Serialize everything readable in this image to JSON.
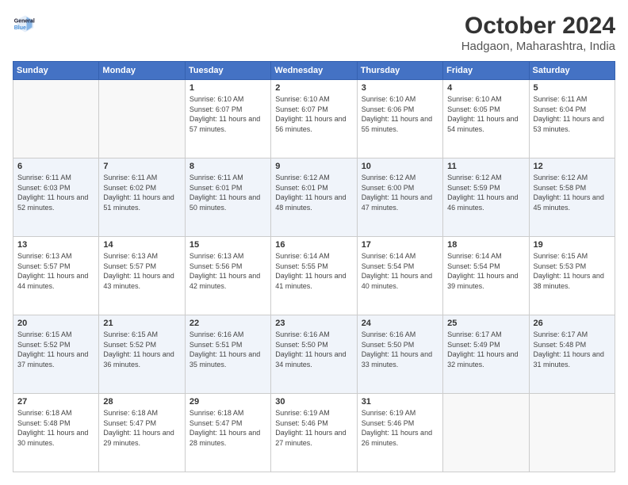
{
  "header": {
    "logo_line1": "General",
    "logo_line2": "Blue",
    "title": "October 2024",
    "subtitle": "Hadgaon, Maharashtra, India"
  },
  "days_of_week": [
    "Sunday",
    "Monday",
    "Tuesday",
    "Wednesday",
    "Thursday",
    "Friday",
    "Saturday"
  ],
  "weeks": [
    [
      {
        "day": "",
        "info": ""
      },
      {
        "day": "",
        "info": ""
      },
      {
        "day": "1",
        "info": "Sunrise: 6:10 AM\nSunset: 6:07 PM\nDaylight: 11 hours and 57 minutes."
      },
      {
        "day": "2",
        "info": "Sunrise: 6:10 AM\nSunset: 6:07 PM\nDaylight: 11 hours and 56 minutes."
      },
      {
        "day": "3",
        "info": "Sunrise: 6:10 AM\nSunset: 6:06 PM\nDaylight: 11 hours and 55 minutes."
      },
      {
        "day": "4",
        "info": "Sunrise: 6:10 AM\nSunset: 6:05 PM\nDaylight: 11 hours and 54 minutes."
      },
      {
        "day": "5",
        "info": "Sunrise: 6:11 AM\nSunset: 6:04 PM\nDaylight: 11 hours and 53 minutes."
      }
    ],
    [
      {
        "day": "6",
        "info": "Sunrise: 6:11 AM\nSunset: 6:03 PM\nDaylight: 11 hours and 52 minutes."
      },
      {
        "day": "7",
        "info": "Sunrise: 6:11 AM\nSunset: 6:02 PM\nDaylight: 11 hours and 51 minutes."
      },
      {
        "day": "8",
        "info": "Sunrise: 6:11 AM\nSunset: 6:01 PM\nDaylight: 11 hours and 50 minutes."
      },
      {
        "day": "9",
        "info": "Sunrise: 6:12 AM\nSunset: 6:01 PM\nDaylight: 11 hours and 48 minutes."
      },
      {
        "day": "10",
        "info": "Sunrise: 6:12 AM\nSunset: 6:00 PM\nDaylight: 11 hours and 47 minutes."
      },
      {
        "day": "11",
        "info": "Sunrise: 6:12 AM\nSunset: 5:59 PM\nDaylight: 11 hours and 46 minutes."
      },
      {
        "day": "12",
        "info": "Sunrise: 6:12 AM\nSunset: 5:58 PM\nDaylight: 11 hours and 45 minutes."
      }
    ],
    [
      {
        "day": "13",
        "info": "Sunrise: 6:13 AM\nSunset: 5:57 PM\nDaylight: 11 hours and 44 minutes."
      },
      {
        "day": "14",
        "info": "Sunrise: 6:13 AM\nSunset: 5:57 PM\nDaylight: 11 hours and 43 minutes."
      },
      {
        "day": "15",
        "info": "Sunrise: 6:13 AM\nSunset: 5:56 PM\nDaylight: 11 hours and 42 minutes."
      },
      {
        "day": "16",
        "info": "Sunrise: 6:14 AM\nSunset: 5:55 PM\nDaylight: 11 hours and 41 minutes."
      },
      {
        "day": "17",
        "info": "Sunrise: 6:14 AM\nSunset: 5:54 PM\nDaylight: 11 hours and 40 minutes."
      },
      {
        "day": "18",
        "info": "Sunrise: 6:14 AM\nSunset: 5:54 PM\nDaylight: 11 hours and 39 minutes."
      },
      {
        "day": "19",
        "info": "Sunrise: 6:15 AM\nSunset: 5:53 PM\nDaylight: 11 hours and 38 minutes."
      }
    ],
    [
      {
        "day": "20",
        "info": "Sunrise: 6:15 AM\nSunset: 5:52 PM\nDaylight: 11 hours and 37 minutes."
      },
      {
        "day": "21",
        "info": "Sunrise: 6:15 AM\nSunset: 5:52 PM\nDaylight: 11 hours and 36 minutes."
      },
      {
        "day": "22",
        "info": "Sunrise: 6:16 AM\nSunset: 5:51 PM\nDaylight: 11 hours and 35 minutes."
      },
      {
        "day": "23",
        "info": "Sunrise: 6:16 AM\nSunset: 5:50 PM\nDaylight: 11 hours and 34 minutes."
      },
      {
        "day": "24",
        "info": "Sunrise: 6:16 AM\nSunset: 5:50 PM\nDaylight: 11 hours and 33 minutes."
      },
      {
        "day": "25",
        "info": "Sunrise: 6:17 AM\nSunset: 5:49 PM\nDaylight: 11 hours and 32 minutes."
      },
      {
        "day": "26",
        "info": "Sunrise: 6:17 AM\nSunset: 5:48 PM\nDaylight: 11 hours and 31 minutes."
      }
    ],
    [
      {
        "day": "27",
        "info": "Sunrise: 6:18 AM\nSunset: 5:48 PM\nDaylight: 11 hours and 30 minutes."
      },
      {
        "day": "28",
        "info": "Sunrise: 6:18 AM\nSunset: 5:47 PM\nDaylight: 11 hours and 29 minutes."
      },
      {
        "day": "29",
        "info": "Sunrise: 6:18 AM\nSunset: 5:47 PM\nDaylight: 11 hours and 28 minutes."
      },
      {
        "day": "30",
        "info": "Sunrise: 6:19 AM\nSunset: 5:46 PM\nDaylight: 11 hours and 27 minutes."
      },
      {
        "day": "31",
        "info": "Sunrise: 6:19 AM\nSunset: 5:46 PM\nDaylight: 11 hours and 26 minutes."
      },
      {
        "day": "",
        "info": ""
      },
      {
        "day": "",
        "info": ""
      }
    ]
  ]
}
